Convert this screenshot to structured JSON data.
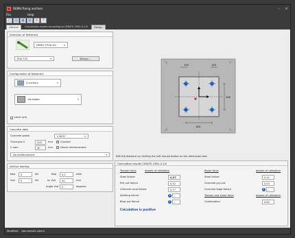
{
  "window": {
    "title": "DEMU fixing anchors"
  },
  "menu": [
    "File",
    "Help"
  ],
  "toolbar": {
    "new": "▯",
    "open": "▤",
    "save": "▦",
    "print": "▧",
    "help": "?",
    "close": "×"
  },
  "tabs": [
    {
      "label": "General"
    },
    {
      "label": "Calculation results according to CEN/TS 1992-4-1/2"
    },
    {
      "label": "Design"
    }
  ],
  "fasteners": {
    "title": "Selection of fasteners",
    "product": "DEMU T-POX GV",
    "size": "POX 125",
    "design_button": "Design ..."
  },
  "config": {
    "title": "Configuration of fasteners",
    "anchors": "4 anchors",
    "edges": "No edges",
    "lever_arm": "Lever arm"
  },
  "concrete": {
    "title": "Concrete data",
    "grade_label": "Concrete grade",
    "grade": "C30/37",
    "thickness_label": "Thickness h",
    "thickness": "200",
    "thickness_unit": "mm",
    "cracked": "Cracked",
    "cnom_label": "C nom",
    "cnom": "30",
    "cnom_unit": "mm",
    "dense": "Dense reinforcement",
    "reinforcement": "No reinforcement"
  },
  "loading": {
    "title": "Anchor loading",
    "nsd_label": "Nsd",
    "nsd": "5",
    "nsd_unit": "kN",
    "msd_label": "Msd",
    "msd": "0,2",
    "msd_unit": "kNm",
    "vsd_label": "Vsd",
    "vsd": "5",
    "vsd_unit": "kN",
    "ecc_label": "ec Vsd",
    "ecc": "50",
    "ecc_unit": "mm",
    "angle_label": "Angle Vsd",
    "angle": "0",
    "angle_unit": "degrees"
  },
  "drawing": {
    "dim_top_left": "150",
    "dim_top_right": "150",
    "dim_right": "100",
    "dim_bottom": "100"
  },
  "hint": "Edit the distance by clicking the Left mouse button on the dimension text.",
  "results": {
    "title": "Calculation results CEN/TS 1992-4-1/2",
    "tension_header": "Tension force",
    "shear_header": "Shear force",
    "degree_header": "degree of utilisation",
    "tension": [
      {
        "label": "Steel failure",
        "value": "0,07"
      },
      {
        "label": "Pull out failure",
        "value": "0.52"
      },
      {
        "label": "Concrete cone failure",
        "value": "0.77"
      },
      {
        "label": "Splitting failure",
        "value": "--"
      },
      {
        "label": "Blow out failure",
        "value": "--"
      }
    ],
    "shear": [
      {
        "label": "Steel failure",
        "value": "0.11"
      },
      {
        "label": "Concrete pry-out",
        "value": "0.03"
      },
      {
        "label": "Concrete edge failure",
        "value": "--"
      }
    ],
    "combined_header": "Tension and shear force",
    "combined_degree_header": "degree of utilisation",
    "combination_label": "Combination",
    "combination": "0.82",
    "status": "Calculation is positive"
  },
  "statusbar": {
    "state": "Modified",
    "file": "document1.demu"
  },
  "colors": {
    "plate": "#c4c4c4",
    "concrete": "#b7b7b7",
    "anchor": "#1f5fbf",
    "result": "#1b3d8f"
  }
}
